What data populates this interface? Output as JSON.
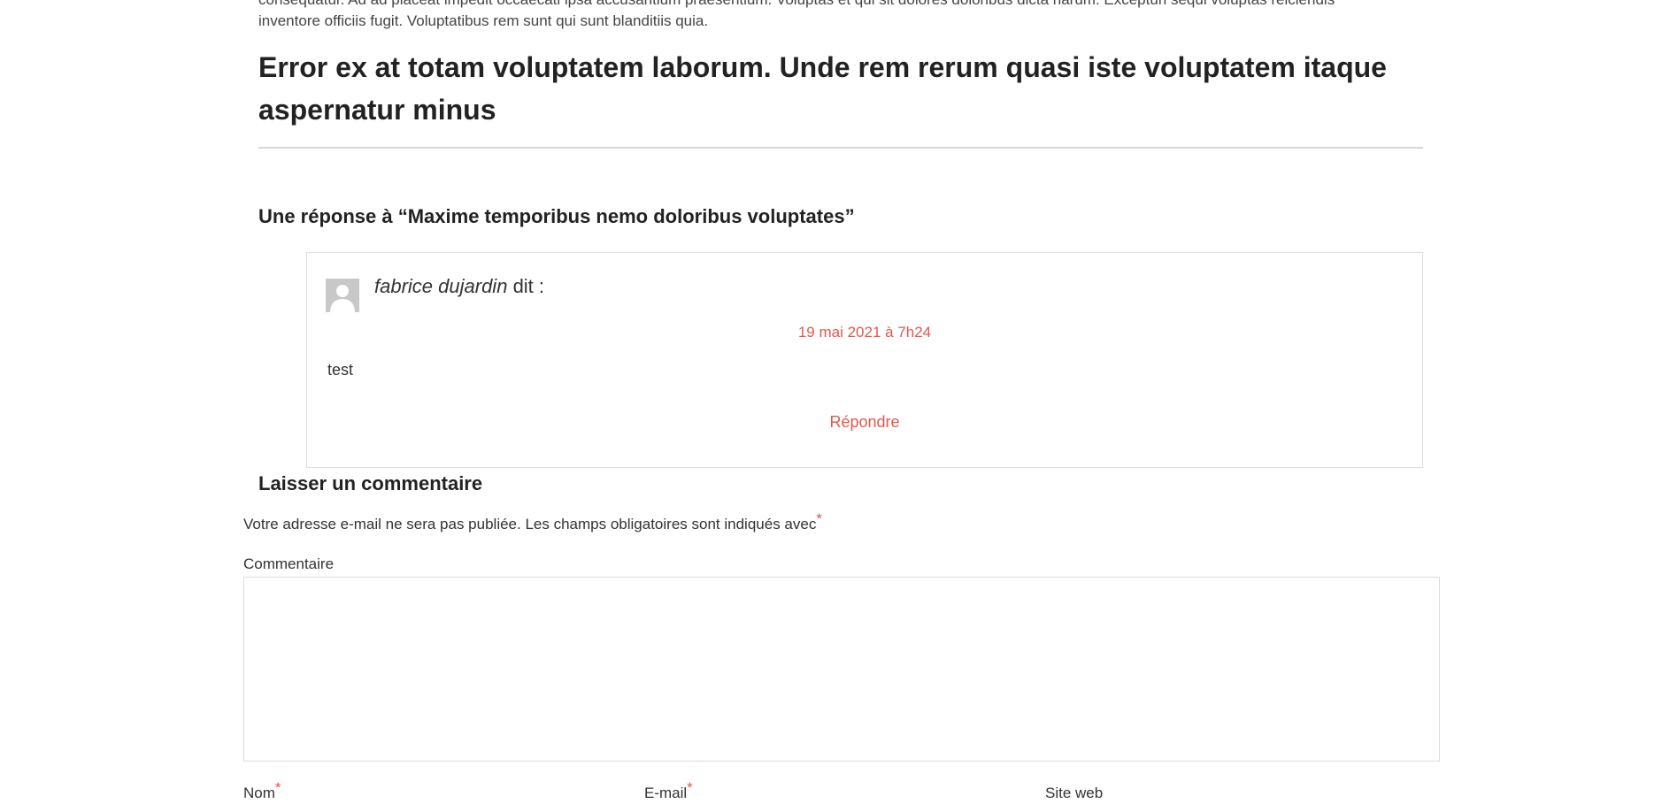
{
  "article": {
    "intro_line1": "consequatur. Ad ad placeat impedit occaecati ipsa accusantium praesentium. Voluptas et qui sit dolores doloribus dicta harum. Excepturi sequi voluptas reiciendis",
    "intro_line2": "inventore officiis fugit. Voluptatibus rem sunt qui sunt blanditiis quia.",
    "heading": "Error ex at totam voluptatem laborum. Unde rem rerum quasi iste voluptatem itaque aspernatur minus"
  },
  "comments": {
    "title": "Une réponse à “Maxime temporibus nemo doloribus voluptates”",
    "items": [
      {
        "author": "fabrice dujardin",
        "says": "dit :",
        "date": "19 mai 2021 à 7h24",
        "text": "test",
        "reply_label": "Répondre"
      }
    ]
  },
  "form": {
    "title": "Laisser un commentaire",
    "notes": "Votre adresse e-mail ne sera pas publiée. Les champs obligatoires sont indiqués avec",
    "required_mark": "*",
    "comment_label": "Commentaire",
    "comment_value": "",
    "name_label": "Nom",
    "email_label": "E-mail",
    "website_label": "Site web"
  },
  "colors": {
    "accent": "#e4574a",
    "text": "#333333",
    "border": "#dddddd"
  }
}
